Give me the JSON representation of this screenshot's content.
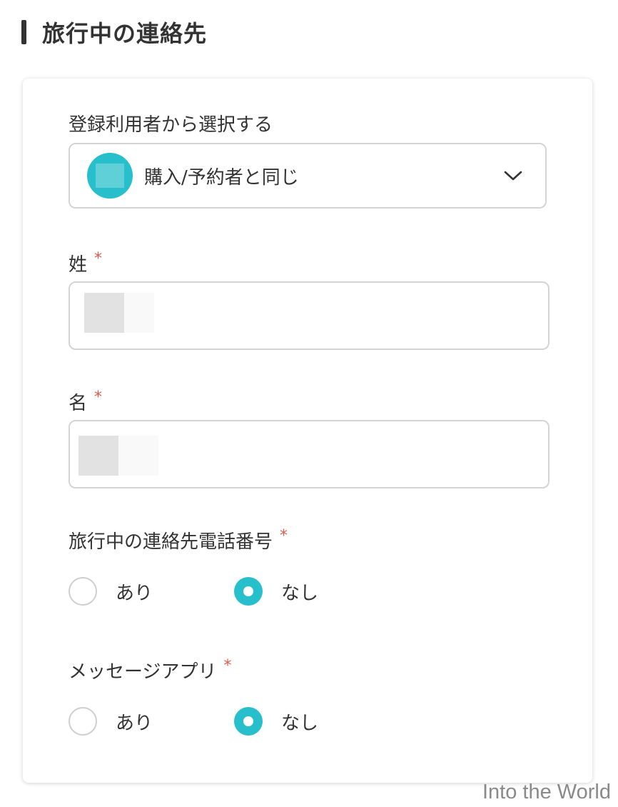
{
  "section": {
    "title": "旅行中の連絡先"
  },
  "form": {
    "registered_user": {
      "label": "登録利用者から選択する",
      "selected_value": "購入/予約者と同じ"
    },
    "last_name": {
      "label": "姓",
      "required_mark": "*"
    },
    "first_name": {
      "label": "名",
      "required_mark": "*"
    },
    "phone": {
      "label": "旅行中の連絡先電話番号",
      "required_mark": "*",
      "options": [
        {
          "label": "あり",
          "checked": false
        },
        {
          "label": "なし",
          "checked": true
        }
      ]
    },
    "message_app": {
      "label": "メッセージアプリ",
      "required_mark": "*",
      "options": [
        {
          "label": "あり",
          "checked": false
        },
        {
          "label": "なし",
          "checked": true
        }
      ]
    }
  },
  "watermark": "Into the World",
  "colors": {
    "accent": "#27bfcb",
    "required": "#e05a4e",
    "border": "#d4d4d4",
    "text": "#333333"
  },
  "icons": {
    "select_chevron": "chevron-down-icon",
    "user_avatar": "avatar"
  }
}
